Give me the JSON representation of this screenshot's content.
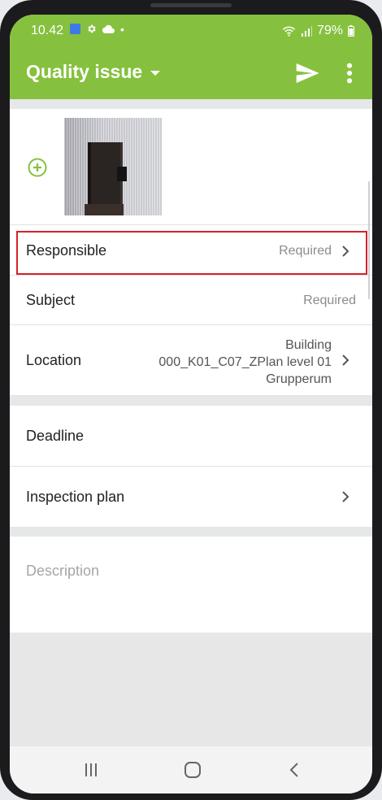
{
  "status_bar": {
    "time": "10.42",
    "battery": "79%",
    "icons_left": [
      "app-badge-icon",
      "gear-icon",
      "cloud-icon",
      "dot-icon"
    ],
    "icons_right": [
      "wifi-icon",
      "signal-icon",
      "battery-icon"
    ]
  },
  "app_bar": {
    "title": "Quality issue",
    "icons": [
      "caret-down-icon",
      "send-icon",
      "more-vertical-icon"
    ]
  },
  "form": {
    "responsible": {
      "label": "Responsible",
      "value": "Required"
    },
    "subject": {
      "label": "Subject",
      "value": "Required"
    },
    "location": {
      "label": "Location",
      "value_lines": [
        "Building",
        "000_K01_C07_ZPlan level 01",
        "Grupperum"
      ]
    },
    "deadline": {
      "label": "Deadline"
    },
    "inspection_plan": {
      "label": "Inspection plan"
    },
    "description": {
      "placeholder": "Description"
    }
  },
  "colors": {
    "accent": "#85c13e",
    "highlight": "#d7222a"
  }
}
